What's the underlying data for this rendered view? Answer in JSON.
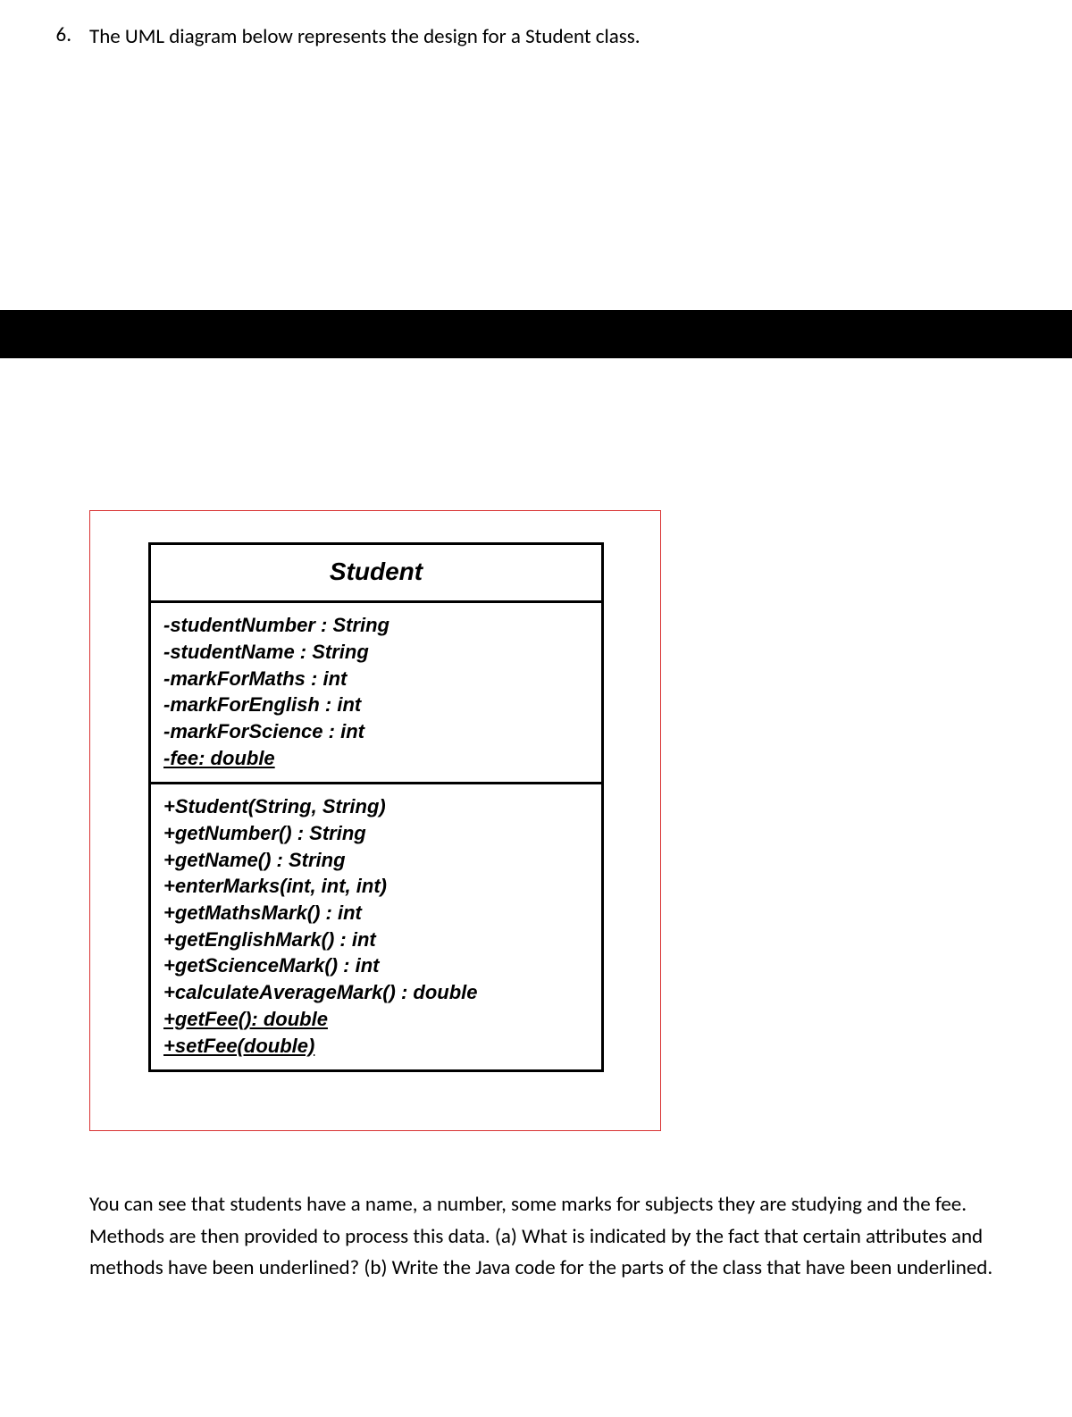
{
  "question": {
    "number": "6.",
    "intro": "The UML diagram below represents the design for a Student class."
  },
  "uml": {
    "className": "Student",
    "attributes": [
      {
        "text": "-studentNumber : String",
        "underlined": false
      },
      {
        "text": "-studentName : String",
        "underlined": false
      },
      {
        "text": "-markForMaths : int",
        "underlined": false
      },
      {
        "text": "-markForEnglish : int",
        "underlined": false
      },
      {
        "text": "-markForScience : int",
        "underlined": false
      },
      {
        "text": "-fee: double",
        "underlined": true
      }
    ],
    "methods": [
      {
        "text": "+Student(String, String)",
        "underlined": false
      },
      {
        "text": "+getNumber() : String",
        "underlined": false
      },
      {
        "text": "+getName() : String",
        "underlined": false
      },
      {
        "text": "+enterMarks(int, int, int)",
        "underlined": false
      },
      {
        "text": "+getMathsMark() : int",
        "underlined": false
      },
      {
        "text": "+getEnglishMark() : int",
        "underlined": false
      },
      {
        "text": "+getScienceMark() : int",
        "underlined": false
      },
      {
        "text": "+calculateAverageMark() : double",
        "underlined": false
      },
      {
        "text": "+getFee(): double",
        "underlined": true
      },
      {
        "text": "+setFee(double)",
        "underlined": true
      }
    ]
  },
  "body": "You can see that students have a name, a number, some marks for subjects they are studying and the fee. Methods are then provided to process this data. (a) What is indicated by the fact that certain attributes and methods have been underlined? (b) Write the Java code for the parts of the class that have been underlined."
}
